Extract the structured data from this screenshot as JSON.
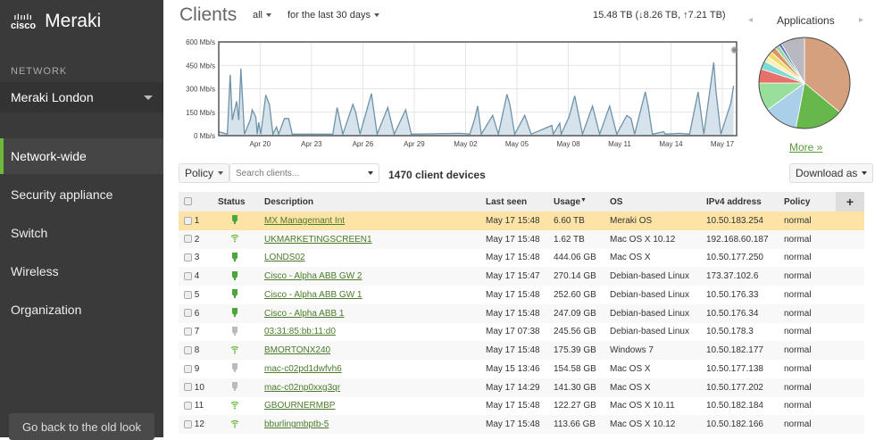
{
  "brand": {
    "cisco": "cisco",
    "product": "Meraki"
  },
  "sidebar": {
    "network_label": "NETWORK",
    "network": "Meraki London",
    "items": [
      {
        "label": "Network-wide",
        "active": true
      },
      {
        "label": "Security appliance"
      },
      {
        "label": "Switch"
      },
      {
        "label": "Wireless"
      },
      {
        "label": "Organization"
      }
    ],
    "old_look": "Go back to the old look"
  },
  "header": {
    "title": "Clients",
    "filter": "all",
    "range": "for the last 30 days",
    "total": "15.48 TB (↓8.26 TB, ↑7.21 TB)"
  },
  "chart_data": [
    {
      "type": "area",
      "ylabel": "",
      "yticks": [
        "0 Mb/s",
        "150 Mb/s",
        "300 Mb/s",
        "450 Mb/s",
        "600 Mb/s"
      ],
      "ylim": [
        0,
        600
      ],
      "xticks": [
        "Apr 20",
        "Apr 23",
        "Apr 26",
        "Apr 29",
        "May 02",
        "May 05",
        "May 08",
        "May 11",
        "May 14",
        "May 17"
      ],
      "grid": true,
      "color": "#6e93a8",
      "fill": "#d6e3ec",
      "points": [
        [
          "Apr 17 14:00",
          25
        ],
        [
          "Apr 18 02:00",
          10
        ],
        [
          "Apr 18 06:00",
          390
        ],
        [
          "Apr 18 09:00",
          100
        ],
        [
          "Apr 18 15:00",
          220
        ],
        [
          "Apr 18 18:00",
          100
        ],
        [
          "Apr 18 21:00",
          430
        ],
        [
          "Apr 19 02:00",
          10
        ],
        [
          "Apr 19 10:00",
          100
        ],
        [
          "Apr 19 13:00",
          165
        ],
        [
          "Apr 19 18:00",
          120
        ],
        [
          "Apr 19 20:00",
          10
        ],
        [
          "Apr 19 22:00",
          85
        ],
        [
          "Apr 20 01:00",
          10
        ],
        [
          "Apr 20 08:00",
          260
        ],
        [
          "Apr 20 13:00",
          200
        ],
        [
          "Apr 20 18:00",
          10
        ],
        [
          "Apr 20 23:00",
          55
        ],
        [
          "Apr 21 02:00",
          10
        ],
        [
          "Apr 21 10:00",
          110
        ],
        [
          "Apr 21 16:00",
          110
        ],
        [
          "Apr 21 21:00",
          10
        ],
        [
          "Apr 24 06:00",
          10
        ],
        [
          "Apr 24 12:00",
          180
        ],
        [
          "Apr 24 20:00",
          10
        ],
        [
          "Apr 25 10:00",
          200
        ],
        [
          "Apr 25 14:00",
          150
        ],
        [
          "Apr 25 20:00",
          10
        ],
        [
          "Apr 26 12:00",
          270
        ],
        [
          "Apr 26 20:00",
          10
        ],
        [
          "Apr 27 11:00",
          180
        ],
        [
          "Apr 27 20:00",
          10
        ],
        [
          "Apr 28 12:00",
          165
        ],
        [
          "Apr 28 20:00",
          10
        ],
        [
          "May 1 18:00",
          15
        ],
        [
          "May 2 06:00",
          10
        ],
        [
          "May 2 13:00",
          110
        ],
        [
          "May 2 17:00",
          190
        ],
        [
          "May 2 22:00",
          10
        ],
        [
          "May 3 14:00",
          130
        ],
        [
          "May 3 22:00",
          10
        ],
        [
          "May 4 10:00",
          265
        ],
        [
          "May 4 14:00",
          200
        ],
        [
          "May 4 21:00",
          10
        ],
        [
          "May 5 11:00",
          130
        ],
        [
          "May 5 20:00",
          10
        ],
        [
          "May 7 01:00",
          65
        ],
        [
          "May 7 03:00",
          10
        ],
        [
          "May 7 12:00",
          80
        ],
        [
          "May 7 14:00",
          10
        ],
        [
          "May 8 01:00",
          120
        ],
        [
          "May 8 09:00",
          255
        ],
        [
          "May 8 20:00",
          10
        ],
        [
          "May 9 10:00",
          190
        ],
        [
          "May 9 20:00",
          10
        ],
        [
          "May 10 10:00",
          190
        ],
        [
          "May 10 20:00",
          10
        ],
        [
          "May 11 10:00",
          130
        ],
        [
          "May 11 16:00",
          110
        ],
        [
          "May 11 21:00",
          10
        ],
        [
          "May 12 12:00",
          280
        ],
        [
          "May 12 16:00",
          190
        ],
        [
          "May 12 22:00",
          10
        ],
        [
          "May 13 14:00",
          25
        ],
        [
          "May 13 16:00",
          10
        ],
        [
          "May 14 12:00",
          15
        ],
        [
          "May 15 02:00",
          10
        ],
        [
          "May 15 14:00",
          280
        ],
        [
          "May 15 22:00",
          10
        ],
        [
          "May 16 12:00",
          470
        ],
        [
          "May 16 15:00",
          290
        ],
        [
          "May 16 22:00",
          10
        ],
        [
          "May 17 12:00",
          210
        ],
        [
          "May 17 15:48",
          320
        ]
      ]
    },
    {
      "type": "pie",
      "title": "Applications",
      "values": [
        36,
        17,
        12,
        10,
        5,
        3,
        2,
        2,
        2,
        1.5,
        1,
        8.5
      ],
      "colors": [
        "#d4a07e",
        "#66b84a",
        "#a9d0e8",
        "#98e09a",
        "#e8706a",
        "#7edbd6",
        "#f8f0b8",
        "#f4d86a",
        "#d9956a",
        "#9ed89a",
        "#5570c8",
        "#b8b8c0"
      ]
    }
  ],
  "applications": {
    "title": "Applications",
    "more": "More »",
    "prev": "◂",
    "next": "▸"
  },
  "toolbar": {
    "policy": "Policy",
    "search_placeholder": "Search clients...",
    "count": "1470 client devices",
    "download": "Download as"
  },
  "table": {
    "headers": [
      "Status",
      "Description",
      "Last seen",
      "Usage",
      "OS",
      "IPv4 address",
      "Policy"
    ],
    "add": "+",
    "rows": [
      [
        "1",
        "wired-online",
        "MX Managemant Int",
        "May 17 15:48",
        "6.60 TB",
        "Meraki OS",
        "10.50.183.254",
        "normal"
      ],
      [
        "2",
        "wireless",
        "UKMARKETINGSCREEN1",
        "May 17 15:48",
        "1.62 TB",
        "Mac OS X 10.12",
        "192.168.60.187",
        "normal"
      ],
      [
        "3",
        "wired-online",
        "LONDS02",
        "May 17 15:48",
        "444.06 GB",
        "Mac OS X",
        "10.50.177.250",
        "normal"
      ],
      [
        "4",
        "wired-online",
        "Cisco - Alpha ABB GW 2",
        "May 17 15:47",
        "270.14 GB",
        "Debian-based Linux",
        "173.37.102.6",
        "normal"
      ],
      [
        "5",
        "wired-online",
        "Cisco - Alpha ABB GW 1",
        "May 17 15:48",
        "252.60 GB",
        "Debian-based Linux",
        "10.50.176.33",
        "normal"
      ],
      [
        "6",
        "wired-online",
        "Cisco - Alpha ABB 1",
        "May 17 15:48",
        "247.09 GB",
        "Debian-based Linux",
        "10.50.176.34",
        "normal"
      ],
      [
        "7",
        "wired-offline",
        "03:31:85:bb:11:d0",
        "May 17 07:38",
        "245.56 GB",
        "Debian-based Linux",
        "10.50.178.3",
        "normal"
      ],
      [
        "8",
        "wireless",
        "BMORTONX240",
        "May 17 15:48",
        "175.39 GB",
        "Windows 7",
        "10.50.182.177",
        "normal"
      ],
      [
        "9",
        "wired-offline",
        "mac-c02pd1dwfvh6",
        "May 15 13:46",
        "154.58 GB",
        "Mac OS X",
        "10.50.177.138",
        "normal"
      ],
      [
        "10",
        "wired-offline",
        "mac-c02np0xxg3qr",
        "May 17 14:29",
        "141.30 GB",
        "Mac OS X",
        "10.50.177.202",
        "normal"
      ],
      [
        "11",
        "wireless",
        "GBOURNERMBP",
        "May 17 15:48",
        "122.27 GB",
        "Mac OS X 10.11",
        "10.50.182.184",
        "normal"
      ],
      [
        "12",
        "wireless",
        "bburlingmbptb-5",
        "May 17 15:48",
        "113.66 GB",
        "Mac OS X 10.12",
        "10.50.182.166",
        "normal"
      ]
    ]
  }
}
